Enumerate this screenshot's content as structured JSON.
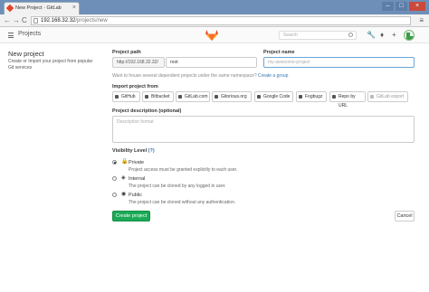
{
  "browser": {
    "tab_title": "New Project · GitLab",
    "tab_close": "×",
    "url_host": "192.168.32.32",
    "url_path": "/projects/new",
    "back_glyph": "←",
    "forward_glyph": "→",
    "reload_glyph": "C",
    "menu_glyph": "≡",
    "window_controls": [
      "–",
      "□",
      "×"
    ]
  },
  "header": {
    "title": "Projects",
    "search_placeholder": "Search",
    "icons": [
      "wrench-icon",
      "bell-icon",
      "plus-icon"
    ],
    "icon_glyphs": {
      "wrench": "🔧",
      "bell": "♦",
      "plus": "+"
    }
  },
  "left": {
    "title": "New project",
    "description": "Create or Import your project from popular Git services"
  },
  "form": {
    "project_path_label": "Project path",
    "path_prefix": "http://192.168.32.32/",
    "namespace": "root",
    "project_name_label": "Project name",
    "project_name_placeholder": "my-awesome-project",
    "namespace_hint": "Want to house several dependent projects under the same namespace?",
    "create_group_link": "Create a group",
    "import_label": "Import project from",
    "import_sources": [
      "GitHub",
      "Bitbucket",
      "GitLab.com",
      "Gitorious.org",
      "Google Code",
      "Fogbugz",
      "Repo by URL",
      "GitLab export"
    ],
    "description_label": "Project description (optional)",
    "description_placeholder": "Description format",
    "visibility_label": "Visibility Level",
    "visibility_help": "(?)",
    "visibility_options": [
      {
        "title": "Private",
        "desc": "Project access must be granted explicitly to each user.",
        "icon": "lock-icon",
        "glyph": "🔒",
        "selected": true
      },
      {
        "title": "Internal",
        "desc": "The project can be cloned by any logged in user.",
        "icon": "shield-icon",
        "glyph": "◈",
        "selected": false
      },
      {
        "title": "Public",
        "desc": "The project can be cloned without any authentication.",
        "icon": "globe-icon",
        "glyph": "◉",
        "selected": false
      }
    ],
    "create_button": "Create project",
    "cancel_button": "Cancel"
  },
  "colors": {
    "accent_green": "#1aaa55",
    "gitlab_orange": "#e24329",
    "link_blue": "#3777b0"
  }
}
